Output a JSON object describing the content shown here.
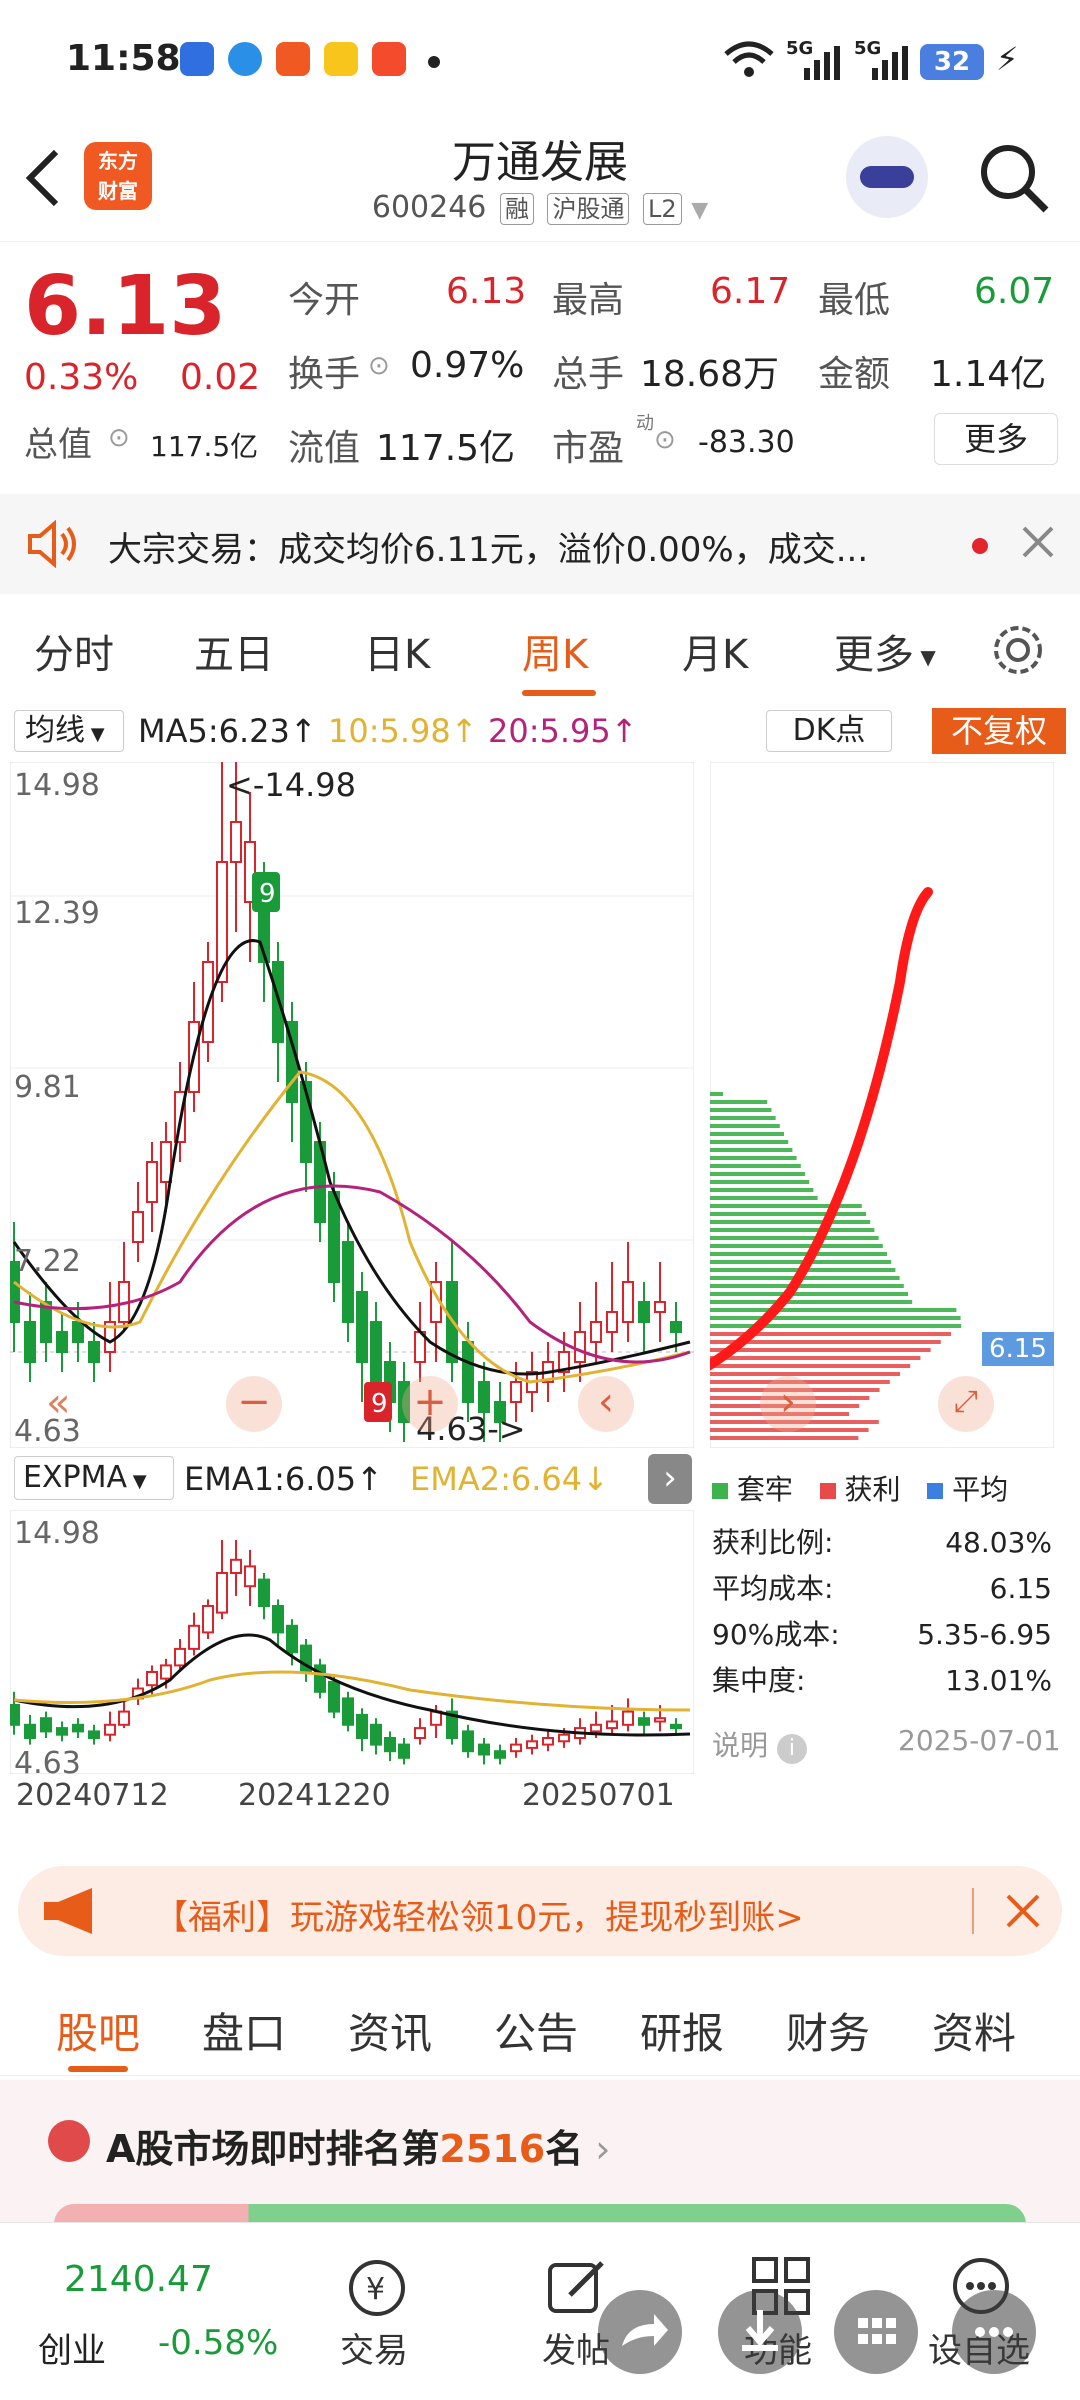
{
  "status": {
    "time": "11:58",
    "battery": "32",
    "net1": "5G",
    "net2": "5G"
  },
  "header": {
    "logo": "东方\n财富",
    "title": "万通发展",
    "code": "600246",
    "tags": [
      "融",
      "沪股通",
      "L2"
    ]
  },
  "quote": {
    "price": "6.13",
    "pct": "0.33%",
    "chg": "0.02",
    "open_label": "今开",
    "open": "6.13",
    "high_label": "最高",
    "high": "6.17",
    "low_label": "最低",
    "low": "6.07",
    "turn_label": "换手",
    "turn": "0.97%",
    "vol_label": "总手",
    "vol": "18.68万",
    "amt_label": "金额",
    "amt": "1.14亿",
    "mcap_label": "总值",
    "mcap": "117.5亿",
    "fmcap_label": "流值",
    "fmcap": "117.5亿",
    "pe_label": "市盈",
    "pe_sup": "动",
    "pe": "-83.30",
    "more": "更多"
  },
  "notice": {
    "text": "大宗交易：成交均价6.11元，溢价0.00%，成交..."
  },
  "tabs": [
    "分时",
    "五日",
    "日K",
    "周K",
    "月K",
    "更多"
  ],
  "chart": {
    "ma_select": "均线",
    "ma5": "MA5:6.23↑",
    "ma10": "10:5.98↑",
    "ma20": "20:5.95↑",
    "dk": "DK点",
    "fq": "不复权",
    "y_labels": [
      "14.98",
      "12.39",
      "9.81",
      "7.22",
      "4.63"
    ],
    "high_mark": "<-14.98",
    "low_mark": "4.63->",
    "exp_select": "EXPMA",
    "ema1": "EMA1:6.05↑",
    "ema2": "EMA2:6.64↓",
    "sub_y": [
      "14.98",
      "4.63"
    ],
    "dates": [
      "20240712",
      "20241220",
      "20250701"
    ],
    "cost_tag": "6.15"
  },
  "chip": {
    "legend": [
      "套牢",
      "获利",
      "平均"
    ],
    "rows": [
      [
        "获利比例:",
        "48.03%"
      ],
      [
        "平均成本:",
        "6.15"
      ],
      [
        "90%成本:",
        "5.35-6.95"
      ],
      [
        "集中度:",
        "13.01%"
      ]
    ],
    "note": "说明",
    "date": "2025-07-01"
  },
  "banner": {
    "text": "【福利】玩游戏轻松领10元，提现秒到账>"
  },
  "subtabs": [
    "股吧",
    "盘口",
    "资讯",
    "公告",
    "研报",
    "财务",
    "资料"
  ],
  "rank": {
    "prefix": "A股市场即时排名第",
    "num": "2516",
    "suffix": "名"
  },
  "bottom": {
    "index": "2140.47",
    "index_name": "创业",
    "index_pct": "-0.58%",
    "items": [
      "交易",
      "发帖",
      "功能",
      "设自选"
    ]
  },
  "chart_data": {
    "type": "candlestick",
    "title": "万通发展 周K",
    "ylim": [
      4.63,
      14.98
    ],
    "x": [
      "20240712",
      "20241220",
      "20250701"
    ],
    "ma": {
      "MA5": 6.23,
      "MA10": 5.98,
      "MA20": 5.95
    },
    "ema": {
      "EMA1": 6.05,
      "EMA2": 6.64
    },
    "high": 14.98,
    "low": 4.63
  },
  "colors": {
    "accent": "#e85c1a",
    "up": "#d8242a",
    "down": "#1a9b3a"
  }
}
